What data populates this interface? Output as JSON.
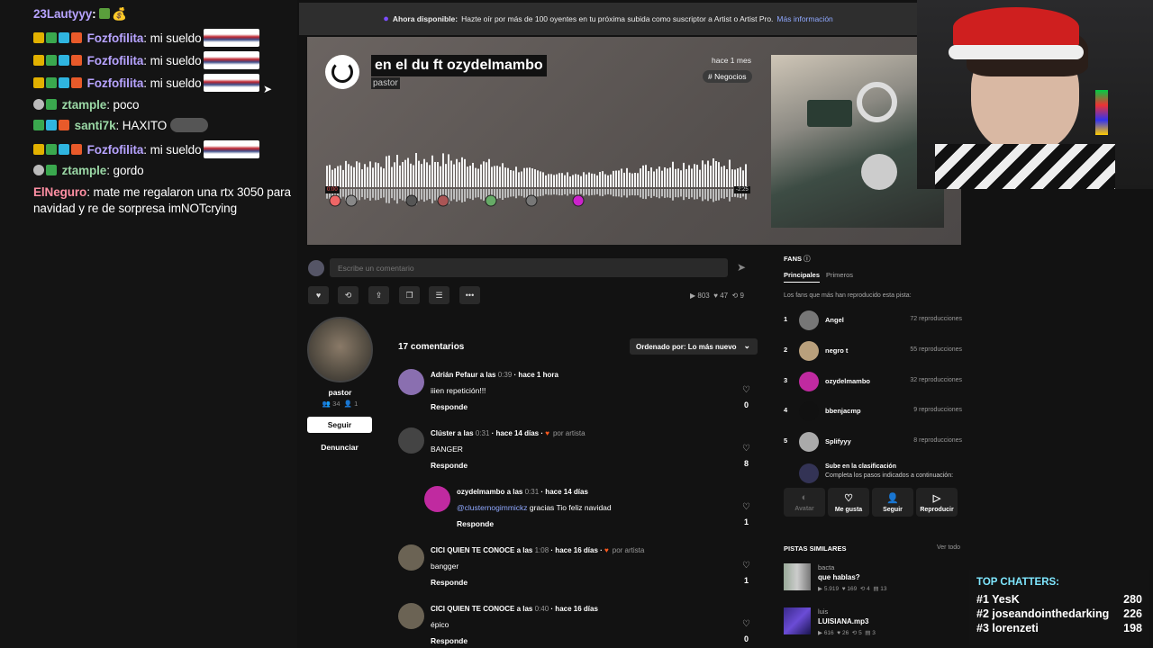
{
  "chat": {
    "messages": [
      {
        "user": "23Lautyyy",
        "color": "#b7a3ff",
        "text": "",
        "emote": "money-emote"
      },
      {
        "user": "Fozfofilita",
        "color": "#b7a3ff",
        "text": "mi sueldo",
        "emote": "flag-emote"
      },
      {
        "user": "Fozfofilita",
        "color": "#b7a3ff",
        "text": "mi sueldo",
        "emote": "flag-emote"
      },
      {
        "user": "Fozfofilita",
        "color": "#b7a3ff",
        "text": "mi sueldo",
        "emote": "flag-emote"
      },
      {
        "user": "ztample",
        "color": "#9ad7a5",
        "text": "poco"
      },
      {
        "user": "santi7k",
        "color": "#9ad7a5",
        "text": "HAXITO"
      },
      {
        "user": "Fozfofilita",
        "color": "#b7a3ff",
        "text": "mi sueldo",
        "emote": "flag-emote"
      },
      {
        "user": "ztample",
        "color": "#9ad7a5",
        "text": "gordo"
      },
      {
        "user": "ElNeguro",
        "color": "#ff8fa3",
        "text": "mate me regalaron una rtx 3050 para navidad y re de sorpresa imNOTcrying"
      }
    ]
  },
  "banner": {
    "bold": "Ahora disponible:",
    "text": "Hazte oír por más de 100 oyentes en tu próxima subida como suscriptor a Artist o Artist Pro.",
    "link": "Más información"
  },
  "track": {
    "title": "en el du ft ozydelmambo",
    "artist": "pastor",
    "posted": "hace 1 mes",
    "tag": "# Negocios",
    "time_start": "0:00",
    "time_end": "-2:25"
  },
  "comment_box": {
    "placeholder": "Escribe un comentario"
  },
  "stats": {
    "plays": "803",
    "likes": "47",
    "reposts": "9"
  },
  "artist": {
    "name": "pastor",
    "followers": "34",
    "following": "1",
    "follow_label": "Seguir",
    "report_label": "Denunciar"
  },
  "comments": {
    "count_label": "17 comentarios",
    "sort_label": "Ordenado por: Lo más nuevo",
    "items": [
      {
        "user": "Adrián Pefaur",
        "at": "a las",
        "time": "0:39",
        "ago": "· hace 1 hora",
        "by_artist": "",
        "text": "iiien repetición!!!",
        "reply": "Responde",
        "likes": "0"
      },
      {
        "user": "Clúster",
        "at": "a las",
        "time": "0:31",
        "ago": "· hace 14 días ·",
        "by_artist": "por artista",
        "text": "BANGER",
        "reply": "Responde",
        "likes": "8"
      },
      {
        "user": "ozydelmambo",
        "at": "a las",
        "time": "0:31",
        "ago": "· hace 14 días",
        "by_artist": "",
        "mention": "@clusternogimmickz",
        "text": " gracias Tio feliz navidad",
        "reply": "Responde",
        "likes": "1"
      },
      {
        "user": "CICI QUIEN TE CONOCE",
        "at": "a las",
        "time": "1:08",
        "ago": "· hace 16 días ·",
        "by_artist": "por artista",
        "text": "bangger",
        "reply": "Responde",
        "likes": "1"
      },
      {
        "user": "CICI QUIEN TE CONOCE",
        "at": "a las",
        "time": "0:40",
        "ago": "· hace 16 días",
        "by_artist": "",
        "text": "épico",
        "reply": "Responde",
        "likes": "0"
      }
    ]
  },
  "fans": {
    "title": "FANS",
    "tab_main": "Principales",
    "tab_first": "Primeros",
    "subtitle": "Los fans que más han reproducido esta pista:",
    "list": [
      {
        "rank": "1",
        "name": "Angel",
        "plays": "72 reproducciones"
      },
      {
        "rank": "2",
        "name": "negro t",
        "plays": "55 reproducciones"
      },
      {
        "rank": "3",
        "name": "ozydelmambo",
        "plays": "32 reproducciones"
      },
      {
        "rank": "4",
        "name": "bbenjacmp",
        "plays": "9 reproducciones"
      },
      {
        "rank": "5",
        "name": "Splifyyy",
        "plays": "8 reproducciones"
      }
    ],
    "climb_title": "Sube en la clasificación",
    "climb_text": "Completa los pasos indicados a continuación:",
    "actions": {
      "avatar": "Avatar",
      "like": "Me gusta",
      "follow": "Seguir",
      "play": "Reproducir"
    }
  },
  "similar": {
    "title": "PISTAS SIMILARES",
    "see_all": "Ver todo",
    "items": [
      {
        "artist": "bacta",
        "title": "que hablas?",
        "plays": "5.919",
        "likes": "169",
        "reposts": "4",
        "comments": "13"
      },
      {
        "artist": "luis",
        "title": "LUISIANA.mp3",
        "plays": "616",
        "likes": "26",
        "reposts": "5",
        "comments": "3"
      }
    ]
  },
  "top_chatters": {
    "title": "TOP CHATTERS:",
    "list": [
      {
        "rank": "#1",
        "name": "YesK",
        "count": "280"
      },
      {
        "rank": "#2",
        "name": "joseandointhedarking",
        "count": "226"
      },
      {
        "rank": "#3",
        "name": "lorenzeti",
        "count": "198"
      }
    ]
  }
}
